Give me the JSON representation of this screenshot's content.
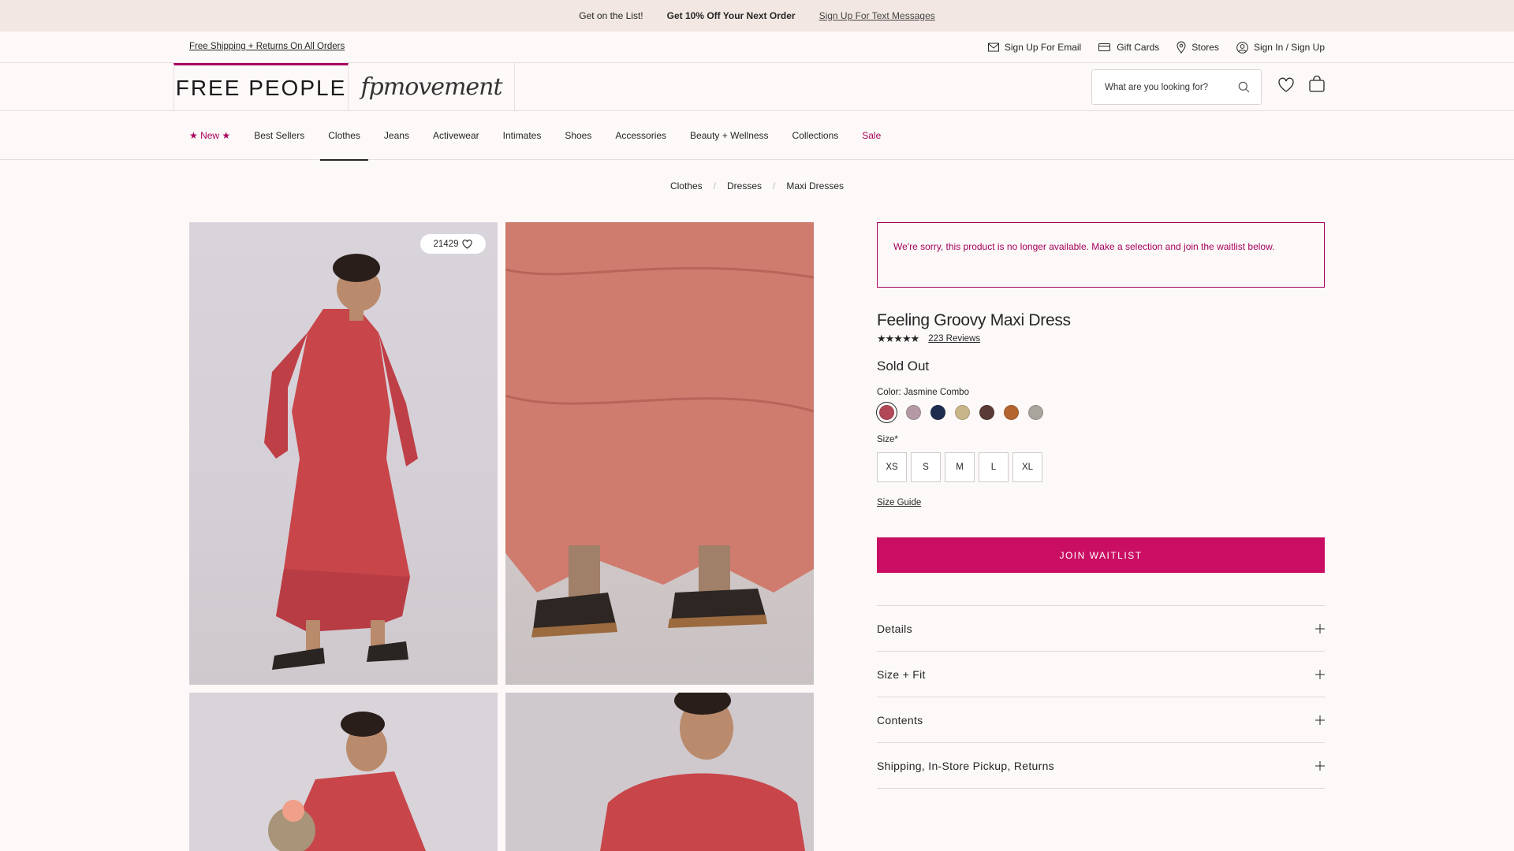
{
  "promo": {
    "list_text": "Get on the List!",
    "offer_text": "Get 10% Off Your Next Order",
    "signup_link": "Sign Up For Text Messages"
  },
  "utility": {
    "shipping_link": "Free Shipping + Returns On All Orders",
    "email": "Sign Up For Email",
    "gift_cards": "Gift Cards",
    "stores": "Stores",
    "sign_in": "Sign In / Sign Up"
  },
  "header": {
    "brand": "FREE PEOPLE",
    "sub_brand": "fpmovement",
    "search_placeholder": "What are you looking for?"
  },
  "nav": {
    "items": [
      "★ New ★",
      "Best Sellers",
      "Clothes",
      "Jeans",
      "Activewear",
      "Intimates",
      "Shoes",
      "Accessories",
      "Beauty + Wellness",
      "Collections",
      "Sale"
    ],
    "active": "Clothes"
  },
  "breadcrumb": [
    "Clothes",
    "Dresses",
    "Maxi Dresses"
  ],
  "gallery": {
    "like_count": "21429"
  },
  "product": {
    "notice": "We're sorry, this product is no longer available. Make a selection and join the waitlist below.",
    "title": "Feeling Groovy Maxi Dress",
    "rating": 4.5,
    "reviews": "223 Reviews",
    "status": "Sold Out",
    "color_label": "Color: Jasmine Combo",
    "swatches": [
      "#b24757",
      "#b39aa5",
      "#1e2c4f",
      "#c9b58a",
      "#5a3a35",
      "#b4642e",
      "#a9a59d"
    ],
    "size_label": "Size*",
    "sizes": [
      "XS",
      "S",
      "M",
      "L",
      "XL"
    ],
    "size_guide": "Size Guide",
    "waitlist_button": "JOIN WAITLIST",
    "accordion": [
      "Details",
      "Size + Fit",
      "Contents",
      "Shipping, In-Store Pickup, Returns"
    ]
  },
  "colors": {
    "accent": "#a6005c",
    "button": "#c90e63",
    "promo_bg": "#f2e7e3"
  }
}
